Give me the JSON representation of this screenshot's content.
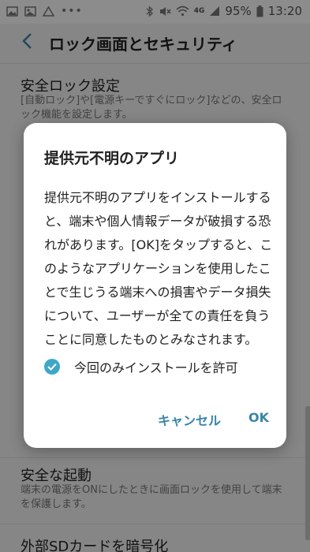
{
  "status_bar": {
    "battery": "95%",
    "time": "13:20",
    "net": "4G"
  },
  "header": {
    "title": "ロック画面とセキュリティ"
  },
  "list": {
    "items": [
      {
        "title": "安全ロック設定",
        "sub": "[自動ロック]や[電源キーですぐにロック]などの、安全ロック機能を設定します。"
      },
      {
        "title": "安全な起動",
        "sub": "端末の電源をONにしたときに画面ロックを使用して端末を保護します。"
      },
      {
        "title": "外部SDカードを暗号化"
      }
    ]
  },
  "dialog": {
    "title": "提供元不明のアプリ",
    "body": "提供元不明のアプリをインストールすると、端末や個人情報データが破損する恐れがあります。[OK]をタップすると、このようなアプリケーションを使用したことで生じうる端末への損害やデータ損失について、ユーザーが全ての責任を負うことに同意したものとみなされます。",
    "checkbox_label": "今回のみインストールを許可",
    "checkbox_checked": true,
    "cancel_label": "キャンセル",
    "ok_label": "OK"
  },
  "colors": {
    "accent": "#3a84a8",
    "checkbox": "#3ea7c8"
  }
}
